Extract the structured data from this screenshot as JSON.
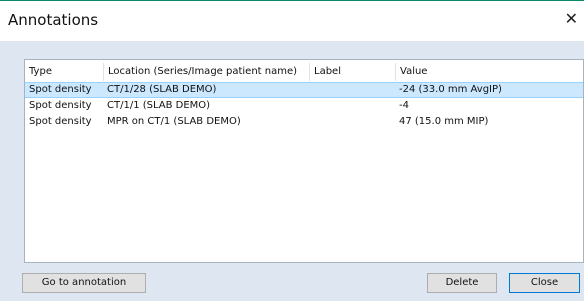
{
  "window": {
    "title": "Annotations",
    "close_glyph": "✕"
  },
  "table": {
    "columns": [
      "Type",
      "Location (Series/Image patient name)",
      "Label",
      "Value"
    ],
    "rows": [
      {
        "type": "Spot density",
        "location": "CT/1/28  (SLAB DEMO)",
        "label": "",
        "value": "-24  (33.0 mm AvgIP)",
        "selected": true
      },
      {
        "type": "Spot density",
        "location": "CT/1/1  (SLAB DEMO)",
        "label": "",
        "value": "-4",
        "selected": false
      },
      {
        "type": "Spot density",
        "location": "MPR on CT/1  (SLAB DEMO)",
        "label": "",
        "value": "47  (15.0 mm MIP)",
        "selected": false
      }
    ]
  },
  "buttons": {
    "goto_label": "Go to annotation",
    "delete_label": "Delete",
    "close_label": "Close"
  },
  "colors": {
    "accent_top_border": "#0a8a6a",
    "body_background": "#dde6f1",
    "selection_background": "#cce8ff",
    "default_button_border": "#0078d7"
  }
}
